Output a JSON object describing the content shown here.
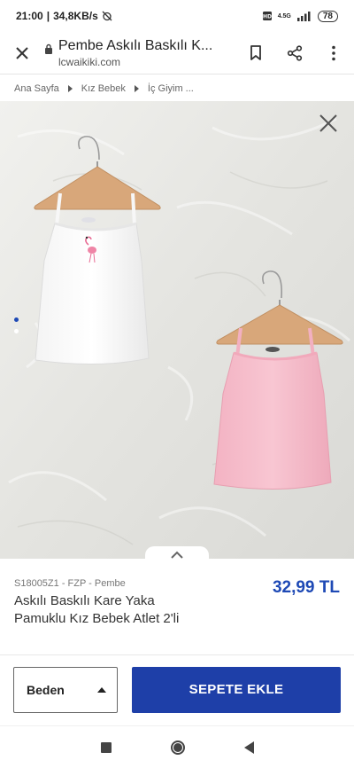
{
  "status": {
    "time": "21:00",
    "speed": "34,8KB/s",
    "network": "4.5G",
    "battery": "78"
  },
  "browser": {
    "title": "Pembe Askılı Baskılı K...",
    "domain": "lcwaikiki.com"
  },
  "breadcrumb": [
    "Ana Sayfa",
    "Kız Bebek",
    "İç Giyim ..."
  ],
  "gallery": {
    "image_count": 2,
    "active_index": 0
  },
  "product": {
    "sku": "S18005Z1 - FZP - Pembe",
    "name": "Askılı Baskılı Kare Yaka Pamuklu Kız Bebek Atlet 2'li",
    "price": "32,99 TL"
  },
  "actions": {
    "size_label": "Beden",
    "add_to_cart": "SEPETE EKLE"
  },
  "colors": {
    "accent": "#1e3fa8",
    "price": "#1e49b5"
  }
}
